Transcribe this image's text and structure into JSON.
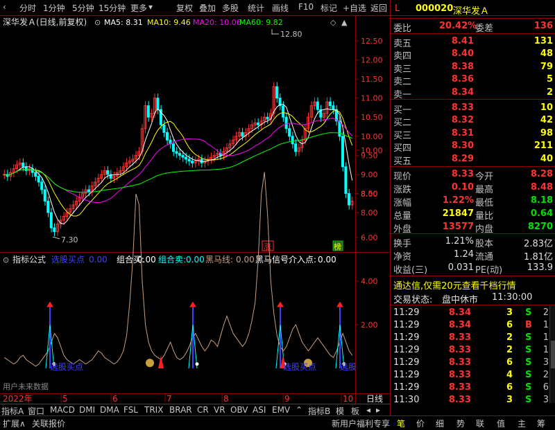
{
  "toolbar": {
    "items": [
      "分时",
      "1分钟",
      "5分钟",
      "15分钟",
      "更多",
      "复权",
      "叠加",
      "多股",
      "统计",
      "画线",
      "F10",
      "标记",
      "+自选",
      "返回"
    ],
    "more_arrow": "▾"
  },
  "stock": {
    "code": "000020",
    "name": "深华发Ａ",
    "flag": "L",
    "chart_title": "深华发Ａ(日线,前复权)"
  },
  "ma": {
    "ma5_label": "MA5: 8.31",
    "ma10_label": "MA10: 9.46",
    "ma20_label": "MA20: 10.06",
    "ma60_label": "MA60: 9.82",
    "ma5_color": "#ffffff",
    "ma10_color": "#ffff00",
    "ma20_color": "#ff00ff",
    "ma60_color": "#00ff00"
  },
  "price_axis": [
    "12.50",
    "12.00",
    "11.50",
    "11.00",
    "10.50",
    "10.00",
    "9.50",
    "9.00",
    "8.50",
    "8.00"
  ],
  "price_high_label": "12.80",
  "price_low_label": "7.30",
  "markers": {
    "limit_up": "涨",
    "ranking": "榜"
  },
  "indicator": {
    "title": "指标公式",
    "items": [
      {
        "label": "选股买点",
        "value": "0.00",
        "color": "#4040ff"
      },
      {
        "label": "组合买:",
        "value": "0.00",
        "color": "#ffffff"
      },
      {
        "label": "组合卖:",
        "value": "0.00",
        "color": "#00ffff"
      },
      {
        "label": "黑马线:",
        "value": "0.00",
        "color": "#c8a080"
      },
      {
        "label": "黑马信号介入点:",
        "value": "0.00",
        "color": "#ffffff"
      }
    ],
    "axis": [
      "10.00",
      "8.00",
      "6.00",
      "4.00",
      "2.00"
    ],
    "buy_point_label": "选股买点",
    "partial_label": "选股",
    "future_text": "用户未来数据"
  },
  "x_axis": {
    "year": "2022年",
    "months": [
      "5",
      "6",
      "7",
      "8",
      "9",
      "10"
    ],
    "period": "日线"
  },
  "index_tabs": [
    "指标A",
    "窗口",
    "MACD",
    "DMI",
    "DMA",
    "FSL",
    "TRIX",
    "BRAR",
    "CR",
    "VR",
    "OBV",
    "ASI",
    "EMV",
    "指标B",
    "模",
    "板"
  ],
  "bottom": {
    "left": [
      "扩展∧",
      "关联报价"
    ],
    "promo": "新用户福利专享",
    "tabs": [
      "笔",
      "价",
      "细",
      "势",
      "联",
      "值",
      "主",
      "筹"
    ]
  },
  "quote": {
    "weibi_label": "委比",
    "weibi": "20.42%",
    "weicha_label": "委差",
    "weicha": "136",
    "asks": [
      {
        "label": "卖五",
        "price": "8.41",
        "vol": "131"
      },
      {
        "label": "卖四",
        "price": "8.40",
        "vol": "48"
      },
      {
        "label": "卖三",
        "price": "8.38",
        "vol": "79"
      },
      {
        "label": "卖二",
        "price": "8.36",
        "vol": "5"
      },
      {
        "label": "卖一",
        "price": "8.34",
        "vol": "2"
      }
    ],
    "bids": [
      {
        "label": "买一",
        "price": "8.33",
        "vol": "10"
      },
      {
        "label": "买二",
        "price": "8.32",
        "vol": "42"
      },
      {
        "label": "买三",
        "price": "8.31",
        "vol": "98"
      },
      {
        "label": "买四",
        "price": "8.30",
        "vol": "211"
      },
      {
        "label": "买五",
        "price": "8.29",
        "vol": "40"
      }
    ],
    "stats": [
      {
        "l1": "现价",
        "v1": "8.33",
        "c1": "red",
        "l2": "今开",
        "v2": "8.28",
        "c2": "red"
      },
      {
        "l1": "涨跌",
        "v1": "0.10",
        "c1": "red",
        "l2": "最高",
        "v2": "8.48",
        "c2": "red"
      },
      {
        "l1": "涨幅",
        "v1": "1.22%",
        "c1": "red",
        "l2": "最低",
        "v2": "8.18",
        "c2": "grn"
      },
      {
        "l1": "总量",
        "v1": "21847",
        "c1": "yel",
        "l2": "量比",
        "v2": "0.64",
        "c2": "grn"
      },
      {
        "l1": "外盘",
        "v1": "13577",
        "c1": "red",
        "l2": "内盘",
        "v2": "8270",
        "c2": "grn"
      }
    ],
    "stats2": [
      {
        "l1": "换手",
        "v1": "1.21%",
        "l2": "股本",
        "v2": "2.83亿"
      },
      {
        "l1": "净资",
        "v1": "1.24",
        "l2": "流通",
        "v2": "1.81亿"
      },
      {
        "l1": "收益(三)",
        "v1": "0.031",
        "l2": "PE(动)",
        "v2": "133.9"
      }
    ],
    "promo": "通达信,仅需20元查看千档行情",
    "status_label": "交易状态:",
    "status": "盘中休市",
    "status_time": "11:30:00",
    "ticks": [
      {
        "time": "11:29",
        "price": "8.34",
        "vol": "3",
        "bs": "S",
        "n": "2"
      },
      {
        "time": "11:29",
        "price": "8.34",
        "vol": "6",
        "bs": "B",
        "n": "1"
      },
      {
        "time": "11:29",
        "price": "8.33",
        "vol": "2",
        "bs": "S",
        "n": "1"
      },
      {
        "time": "11:29",
        "price": "8.33",
        "vol": "2",
        "bs": "S",
        "n": "1"
      },
      {
        "time": "11:29",
        "price": "8.33",
        "vol": "6",
        "bs": "S",
        "n": "3"
      },
      {
        "time": "11:29",
        "price": "8.33",
        "vol": "4",
        "bs": "S",
        "n": "2"
      },
      {
        "time": "11:29",
        "price": "8.33",
        "vol": "6",
        "bs": "S",
        "n": "6"
      },
      {
        "time": "11:30",
        "price": "8.33",
        "vol": "3",
        "bs": "S",
        "n": "3"
      }
    ]
  }
}
